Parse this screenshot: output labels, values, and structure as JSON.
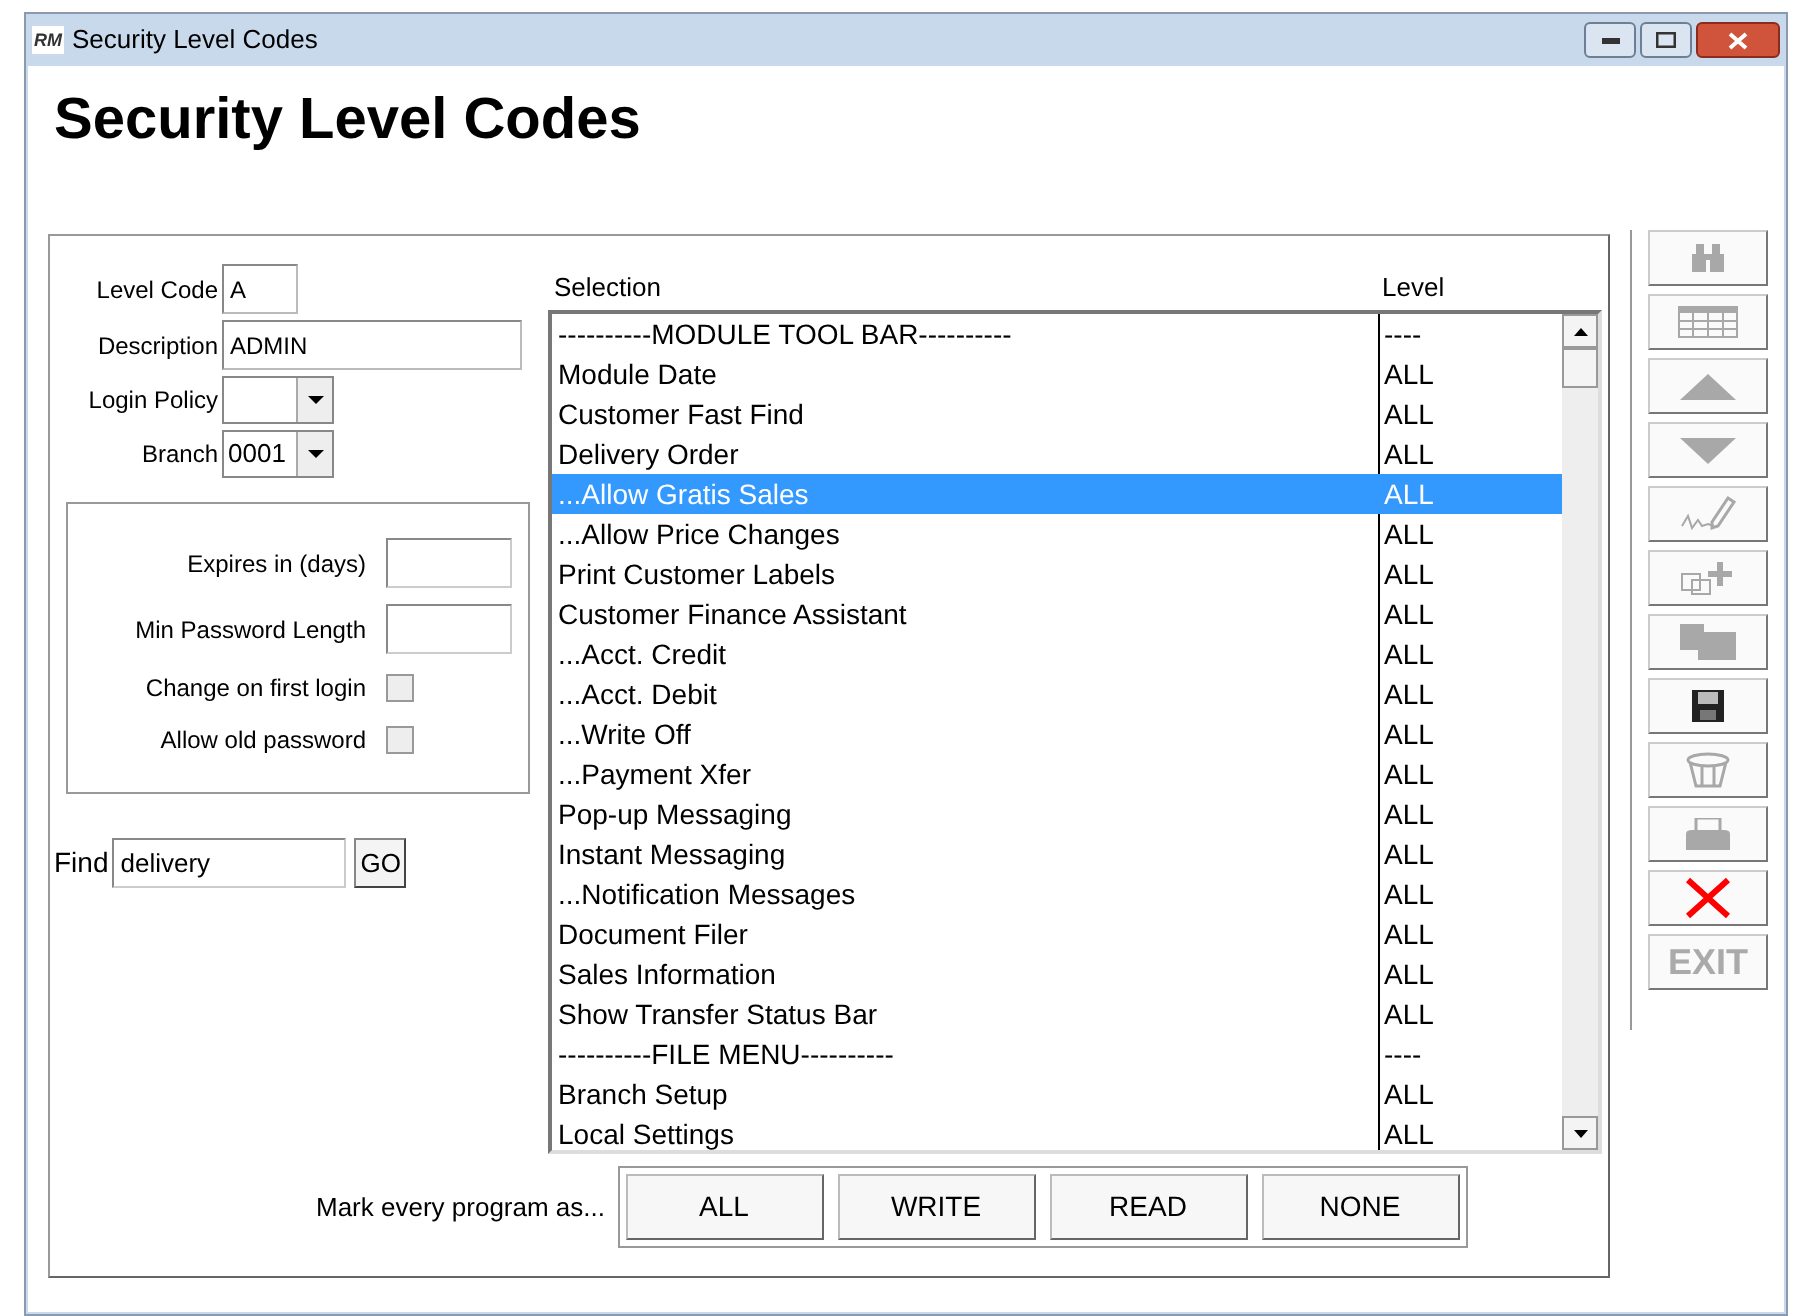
{
  "window": {
    "title": "Security Level Codes",
    "app_badge": "RM"
  },
  "heading": "Security Level Codes",
  "form": {
    "fields": [
      {
        "label": "Level Code",
        "kind": "text",
        "value": "A"
      },
      {
        "label": "Description",
        "kind": "text",
        "value": "ADMIN"
      },
      {
        "label": "Login Policy",
        "kind": "dropdown"
      },
      {
        "label": "Branch",
        "kind": "dropdown",
        "value": "0001"
      }
    ],
    "policy": [
      {
        "label": "Expires in (days)",
        "kind": "text"
      },
      {
        "label": "Min Password Length",
        "kind": "text"
      },
      {
        "label": "Change on first login",
        "kind": "checkbox",
        "checked": false
      },
      {
        "label": "Allow old password",
        "kind": "checkbox",
        "checked": false
      }
    ],
    "find": {
      "label": "Find",
      "value": "delivery",
      "button": "GO"
    }
  },
  "list": {
    "columns": [
      "Selection",
      "Level"
    ],
    "rows": [
      {
        "selection": "----------MODULE TOOL BAR----------",
        "level": "----",
        "selected": false
      },
      {
        "selection": "Module Date",
        "level": "ALL",
        "selected": false
      },
      {
        "selection": "Customer Fast Find",
        "level": "ALL",
        "selected": false
      },
      {
        "selection": "Delivery Order",
        "level": "ALL",
        "selected": false
      },
      {
        "selection": "...Allow Gratis Sales",
        "level": "ALL",
        "selected": true
      },
      {
        "selection": "...Allow Price Changes",
        "level": "ALL",
        "selected": false
      },
      {
        "selection": "Print Customer Labels",
        "level": "ALL",
        "selected": false
      },
      {
        "selection": "Customer Finance Assistant",
        "level": "ALL",
        "selected": false
      },
      {
        "selection": "...Acct. Credit",
        "level": "ALL",
        "selected": false
      },
      {
        "selection": "...Acct. Debit",
        "level": "ALL",
        "selected": false
      },
      {
        "selection": "...Write Off",
        "level": "ALL",
        "selected": false
      },
      {
        "selection": "...Payment Xfer",
        "level": "ALL",
        "selected": false
      },
      {
        "selection": "Pop-up Messaging",
        "level": "ALL",
        "selected": false
      },
      {
        "selection": "Instant Messaging",
        "level": "ALL",
        "selected": false
      },
      {
        "selection": "...Notification Messages",
        "level": "ALL",
        "selected": false
      },
      {
        "selection": "Document Filer",
        "level": "ALL",
        "selected": false
      },
      {
        "selection": "Sales Information",
        "level": "ALL",
        "selected": false
      },
      {
        "selection": "Show Transfer Status Bar",
        "level": "ALL",
        "selected": false
      },
      {
        "selection": "----------FILE MENU----------",
        "level": "----",
        "selected": false
      },
      {
        "selection": "Branch Setup",
        "level": "ALL",
        "selected": false
      },
      {
        "selection": "Local Settings",
        "level": "ALL",
        "selected": false
      }
    ]
  },
  "mark_all": {
    "label": "Mark every program as...",
    "buttons": [
      "ALL",
      "WRITE",
      "READ",
      "NONE"
    ]
  },
  "toolbar": [
    {
      "kind": "binoculars",
      "disabled": true
    },
    {
      "kind": "grid",
      "disabled": true
    },
    {
      "kind": "up",
      "disabled": true
    },
    {
      "kind": "down",
      "disabled": true
    },
    {
      "kind": "signature",
      "disabled": true
    },
    {
      "kind": "add",
      "disabled": true
    },
    {
      "kind": "folder",
      "disabled": true
    },
    {
      "kind": "save",
      "disabled": false
    },
    {
      "kind": "basket",
      "disabled": true
    },
    {
      "kind": "printer",
      "disabled": true
    },
    {
      "kind": "delete",
      "disabled": false
    },
    {
      "kind": "exit",
      "disabled": true,
      "label": "EXIT"
    }
  ]
}
